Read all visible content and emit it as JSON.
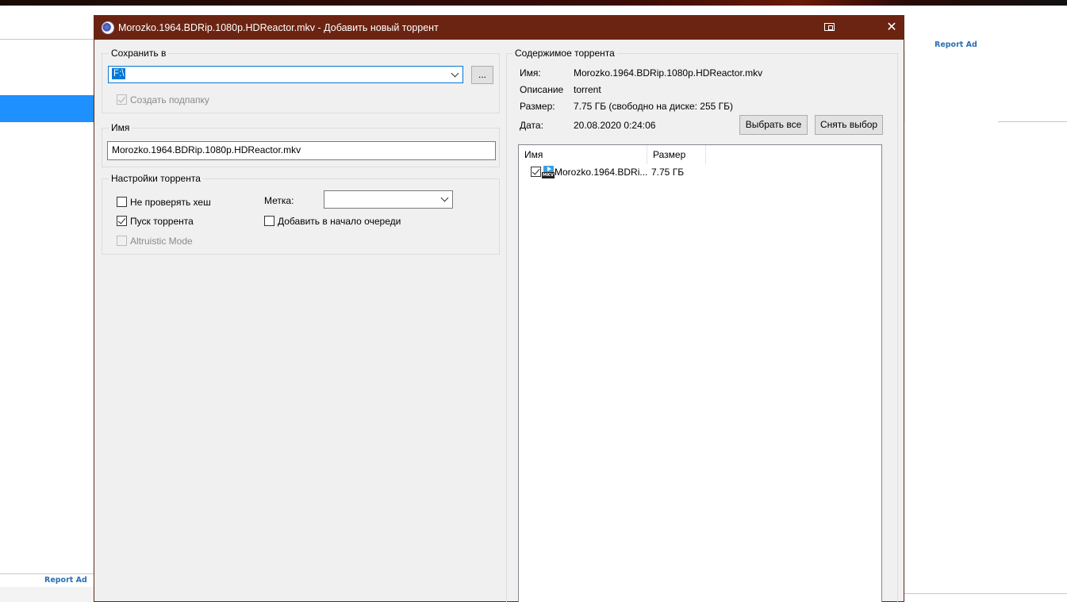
{
  "background": {
    "report_ad_top": "Report Ad",
    "report_ad_bottom": "Report Ad"
  },
  "dialog": {
    "title": "Morozko.1964.BDRip.1080p.HDReactor.mkv - Добавить новый торрент",
    "close_glyph": "✕"
  },
  "save_to": {
    "legend": "Сохранить в",
    "path": "F:\\",
    "browse_label": "...",
    "create_subfolder_label": "Создать подпапку",
    "create_subfolder_checked": true
  },
  "name": {
    "legend": "Имя",
    "value": "Morozko.1964.BDRip.1080p.HDReactor.mkv"
  },
  "settings": {
    "legend": "Настройки торрента",
    "skip_hash_label": "Не проверять хеш",
    "skip_hash_checked": false,
    "start_label": "Пуск торрента",
    "start_checked": true,
    "altruistic_label": "Altruistic Mode",
    "altruistic_checked": false,
    "label_caption": "Метка:",
    "label_value": "",
    "add_to_top_label": "Добавить в начало очереди",
    "add_to_top_checked": false
  },
  "contents": {
    "legend": "Содержимое торрента",
    "name_key": "Имя:",
    "name_val": "Morozko.1964.BDRip.1080p.HDReactor.mkv",
    "desc_key": "Описание",
    "desc_val": "torrent",
    "size_key": "Размер:",
    "size_val": "7.75 ГБ (свободно на диске: 255 ГБ)",
    "date_key": "Дата:",
    "date_val": "20.08.2020 0:24:06",
    "select_all_label": "Выбрать все",
    "deselect_label": "Снять выбор",
    "columns": [
      "Имя",
      "Размер"
    ],
    "files": [
      {
        "name": "Morozko.1964.BDRi...",
        "size": "7.75 ГБ",
        "checked": true,
        "icon": "mkv-file-icon",
        "icon_text": "MKV"
      }
    ]
  },
  "colors": {
    "titlebar": "#6b2412",
    "accent": "#0078d7"
  }
}
